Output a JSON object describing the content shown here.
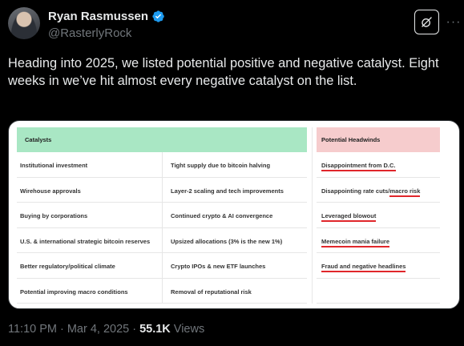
{
  "author": {
    "display_name": "Ryan Rasmussen",
    "handle": "@RasterlyRock",
    "verified_color": "#1d9bf0"
  },
  "tweet": {
    "text": "Heading into 2025, we listed potential positive and negative catalyst. Eight weeks in we’ve hit almost every negative catalyst on the list."
  },
  "table": {
    "catalysts_header": "Catalysts",
    "headwinds_header": "Potential Headwinds",
    "rows": [
      {
        "c1": "Institutional investment",
        "c2": "Tight supply due to bitcoin halving",
        "c3": "Disappointment from D.C."
      },
      {
        "c1": "Wirehouse approvals",
        "c2": "Layer-2 scaling and tech improvements",
        "c3a": "Disappointing rate cuts/",
        "c3b": "macro risk"
      },
      {
        "c1": "Buying by corporations",
        "c2": "Continued crypto & AI convergence",
        "c3": "Leveraged blowout"
      },
      {
        "c1": "U.S. & international strategic bitcoin reserves",
        "c2": "Upsized allocations (3% is the new 1%)",
        "c3": "Memecoin mania failure"
      },
      {
        "c1": "Better regulatory/political climate",
        "c2": "Crypto IPOs & new ETF launches",
        "c3": "Fraud and negative headlines"
      },
      {
        "c1": "Potential improving macro conditions",
        "c2": "Removal of reputational risk",
        "c3": ""
      }
    ],
    "catalysts_color": "#a9e7c4",
    "headwinds_color": "#f6cccd",
    "underline_color": "#e0262b"
  },
  "meta": {
    "time": "11:10 PM",
    "sep1": "·",
    "date": "Mar 4, 2025",
    "sep2": "·",
    "views_count": "55.1K",
    "views_label": "Views"
  }
}
